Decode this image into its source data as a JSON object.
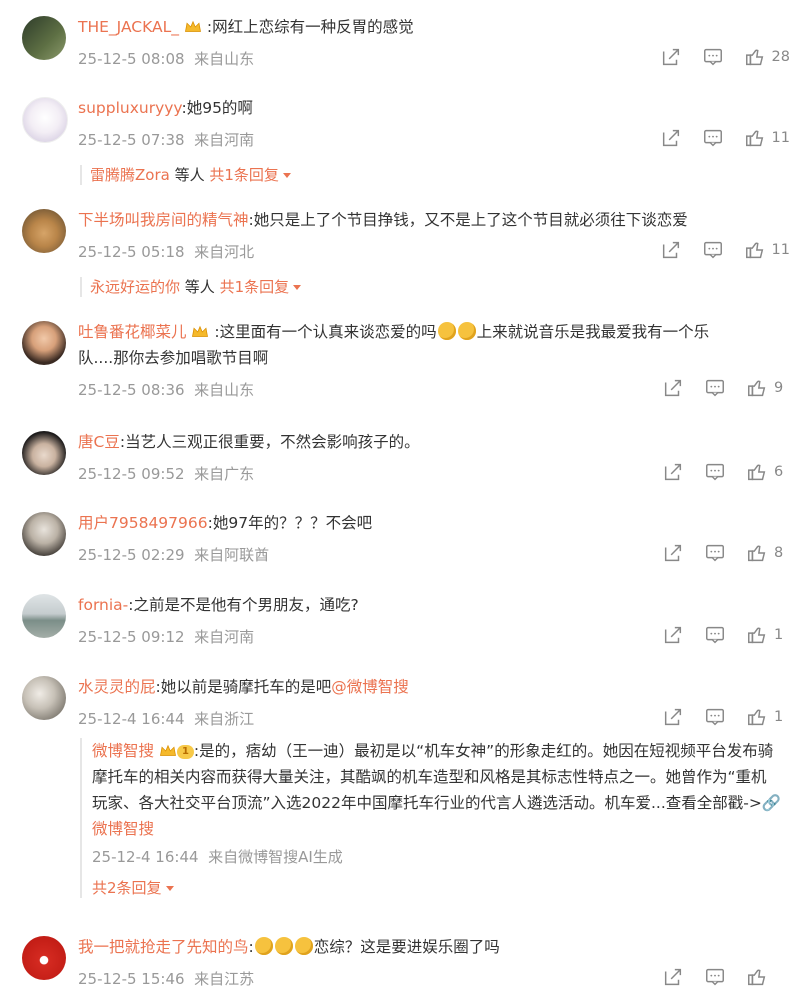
{
  "comments": [
    {
      "name": "THE_JACKAL_",
      "sep": ":",
      "text": "网红上恋综有一种反胃的感觉",
      "time": "25-12-5 08:08",
      "loc": "来自山东",
      "likes": "28"
    },
    {
      "name": "suppluxuryyy",
      "sep": ":",
      "text": "她95的啊",
      "time": "25-12-5 07:38",
      "loc": "来自河南",
      "likes": "11",
      "reply": {
        "user": "雷腾腾Zora",
        "others": " 等人 ",
        "count": "共1条回复"
      }
    },
    {
      "name": "下半场叫我房间的精气神",
      "sep": ":",
      "text": "她只是上了个节目挣钱，又不是上了这个节目就必须往下谈恋爱",
      "time": "25-12-5 05:18",
      "loc": "来自河北",
      "likes": "11",
      "reply": {
        "user": "永远好运的你",
        "others": " 等人 ",
        "count": "共1条回复"
      }
    },
    {
      "name": "吐鲁番花椰菜儿",
      "sep": ":",
      "text": "这里面有一个认真来谈恋爱的吗",
      "text2": "上来就说音乐是我最爱我有一个乐",
      "text3": "队....那你去参加唱歌节目啊",
      "time": "25-12-5 08:36",
      "loc": "来自山东",
      "likes": "9"
    },
    {
      "name": "唐C豆",
      "sep": ":",
      "text": "当艺人三观正很重要，不然会影响孩子的。",
      "time": "25-12-5 09:52",
      "loc": "来自广东",
      "likes": "6"
    },
    {
      "name": "用户7958497966",
      "sep": ":",
      "text": "她97年的？？？不会吧",
      "time": "25-12-5 02:29",
      "loc": "来自阿联酋",
      "likes": "8"
    },
    {
      "name": "fornia-",
      "sep": ":",
      "text": "之前是不是他有个男朋友，通吃?",
      "time": "25-12-5 09:12",
      "loc": "来自河南",
      "likes": "1"
    },
    {
      "name": "水灵灵的屁",
      "sep": ":",
      "text": "她以前是骑摩托车的是吧",
      "mention": "@微博智搜",
      "time": "25-12-4 16:44",
      "loc": "来自浙江",
      "likes": "1",
      "sub": {
        "name": "微博智搜",
        "badge": "1",
        "text": ":是的，痞幼（王一迪）最初是以“机车女神”的形象走红的。她因在短视频平台发布骑摩托车的相关内容而获得大量关注，其酷飒的机车造型和风格是其标志性特点之一。她曾作为“重机玩家、各大社交平台顶流”入选2022年中国摩托车行业的代言人遴选活动。机车爱...查看全部戳->",
        "link": "微博智搜",
        "time": "25-12-4 16:44",
        "loc": "来自微博智搜AI生成",
        "count": "共2条回复"
      }
    },
    {
      "name": "我一把就抢走了先知的鸟",
      "sep": ":",
      "text": "恋综？这是要进娱乐圈了吗",
      "time": "25-12-5 15:46",
      "loc": "来自江苏",
      "likes": ""
    }
  ],
  "icons": {
    "share": "share-icon",
    "comment": "comment-icon",
    "like": "like-icon"
  },
  "colors": {
    "accent": "#eb7350",
    "meta": "#999999"
  }
}
